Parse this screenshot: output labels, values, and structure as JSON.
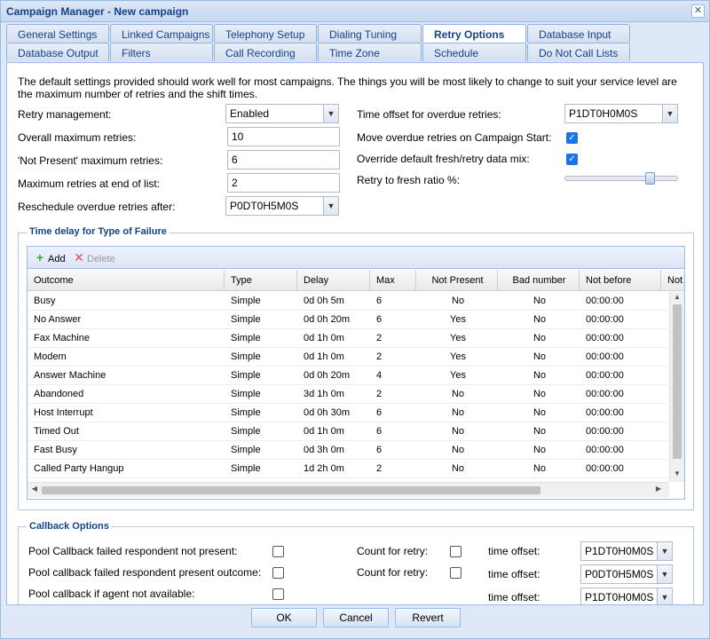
{
  "window": {
    "title": "Campaign Manager - New campaign",
    "close_icon": "close-icon"
  },
  "tabs": {
    "row1": [
      "General Settings",
      "Linked Campaigns",
      "Telephony Setup",
      "Dialing Tuning",
      "Retry Options",
      "Database Input"
    ],
    "row2": [
      "Database Output",
      "Filters",
      "Call Recording",
      "Time Zone",
      "Schedule",
      "Do Not Call Lists"
    ],
    "active": "Retry Options"
  },
  "intro_text": "The default settings provided should work well for most campaigns. The things you will be most likely to change to suit your service level are the maximum number of retries and the shift times.",
  "left_form": {
    "retry_management_label": "Retry management:",
    "retry_management_value": "Enabled",
    "overall_max_label": "Overall maximum retries:",
    "overall_max_value": "10",
    "not_present_label": "'Not Present' maximum retries:",
    "not_present_value": "6",
    "end_of_list_label": "Maximum retries at end of list:",
    "end_of_list_value": "2",
    "reschedule_label": "Reschedule overdue retries after:",
    "reschedule_value": "P0DT0H5M0S"
  },
  "right_form": {
    "time_offset_label": "Time offset for overdue retries:",
    "time_offset_value": "P1DT0H0M0S",
    "move_overdue_label": "Move overdue retries on Campaign Start:",
    "move_overdue_checked": true,
    "override_mix_label": "Override default fresh/retry data mix:",
    "override_mix_checked": true,
    "retry_fresh_label": "Retry to fresh ratio %:",
    "retry_fresh_level": 0.78
  },
  "failure_section": {
    "legend": "Time delay for Type of Failure",
    "add_label": "Add",
    "delete_label": "Delete",
    "columns": [
      "Outcome",
      "Type",
      "Delay",
      "Max",
      "Not Present",
      "Bad number",
      "Not before",
      "Not"
    ],
    "rows": [
      [
        "Busy",
        "Simple",
        "0d 0h 5m",
        "6",
        "No",
        "No",
        "00:00:00"
      ],
      [
        "No Answer",
        "Simple",
        "0d 0h 20m",
        "6",
        "Yes",
        "No",
        "00:00:00"
      ],
      [
        "Fax Machine",
        "Simple",
        "0d 1h 0m",
        "2",
        "Yes",
        "No",
        "00:00:00"
      ],
      [
        "Modem",
        "Simple",
        "0d 1h 0m",
        "2",
        "Yes",
        "No",
        "00:00:00"
      ],
      [
        "Answer Machine",
        "Simple",
        "0d 0h 20m",
        "4",
        "Yes",
        "No",
        "00:00:00"
      ],
      [
        "Abandoned",
        "Simple",
        "3d 1h 0m",
        "2",
        "No",
        "No",
        "00:00:00"
      ],
      [
        "Host Interrupt",
        "Simple",
        "0d 0h 30m",
        "6",
        "No",
        "No",
        "00:00:00"
      ],
      [
        "Timed Out",
        "Simple",
        "0d 1h 0m",
        "6",
        "No",
        "No",
        "00:00:00"
      ],
      [
        "Fast Busy",
        "Simple",
        "0d 3h 0m",
        "6",
        "No",
        "No",
        "00:00:00"
      ],
      [
        "Called Party Hangup",
        "Simple",
        "1d 2h 0m",
        "2",
        "No",
        "No",
        "00:00:00"
      ]
    ]
  },
  "callback_section": {
    "legend": "Callback Options",
    "pool_not_present_label": "Pool Callback failed respondent not present:",
    "pool_present_outcome_label": "Pool callback failed respondent present outcome:",
    "pool_agent_label": "Pool callback if agent not available:",
    "count_for_retry_label": "Count for retry:",
    "time_offset_label": "time offset:",
    "offsets": [
      "P1DT0H0M0S",
      "P0DT0H5M0S",
      "P1DT0H0M0S"
    ]
  },
  "buttons": {
    "ok": "OK",
    "cancel": "Cancel",
    "revert": "Revert"
  },
  "colors": {
    "title_text": "#15428b",
    "window_bg": "#dfe8f6",
    "checkbox_on": "#1a73e8",
    "add_icon": "#3aa53a",
    "delete_icon": "#e05050"
  }
}
